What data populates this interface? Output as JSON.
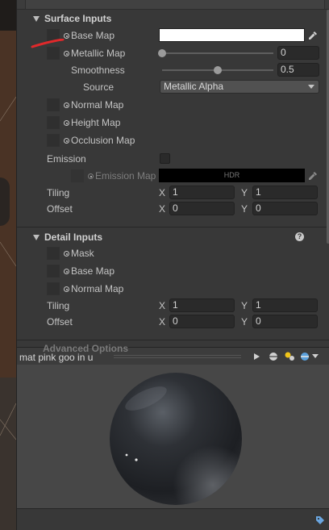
{
  "surface_inputs": {
    "header": "Surface Inputs",
    "base_map_label": "Base Map",
    "base_color": "#ffffff",
    "metallic_label": "Metallic Map",
    "metallic_value": "0",
    "smoothness_label": "Smoothness",
    "smoothness_value": "0.5",
    "smoothness_fraction": 0.5,
    "source_label": "Source",
    "source_value": "Metallic Alpha",
    "normal_label": "Normal Map",
    "height_label": "Height Map",
    "occlusion_label": "Occlusion Map",
    "emission_label": "Emission",
    "emission_map_label": "Emission Map",
    "emission_field": "HDR",
    "tiling_label": "Tiling",
    "tiling_x": "1",
    "tiling_y": "1",
    "offset_label": "Offset",
    "offset_x": "0",
    "offset_y": "0"
  },
  "detail_inputs": {
    "header": "Detail Inputs",
    "help": "?",
    "mask_label": "Mask",
    "base_map_label": "Base Map",
    "normal_label": "Normal Map",
    "tiling_label": "Tiling",
    "tiling_x": "1",
    "tiling_y": "1",
    "offset_label": "Offset",
    "offset_x": "0",
    "offset_y": "0"
  },
  "axis": {
    "x": "X",
    "y": "Y"
  },
  "advanced_partial": "Advanced Options",
  "preview": {
    "title": "mat pink goo in u",
    "buttons": [
      "play-icon",
      "sphere-icon",
      "light-icon",
      "material-ball-icon",
      "dropdown-icon"
    ]
  },
  "colors": {
    "annotation": "#e0292b",
    "accent": "#3a79bb"
  }
}
